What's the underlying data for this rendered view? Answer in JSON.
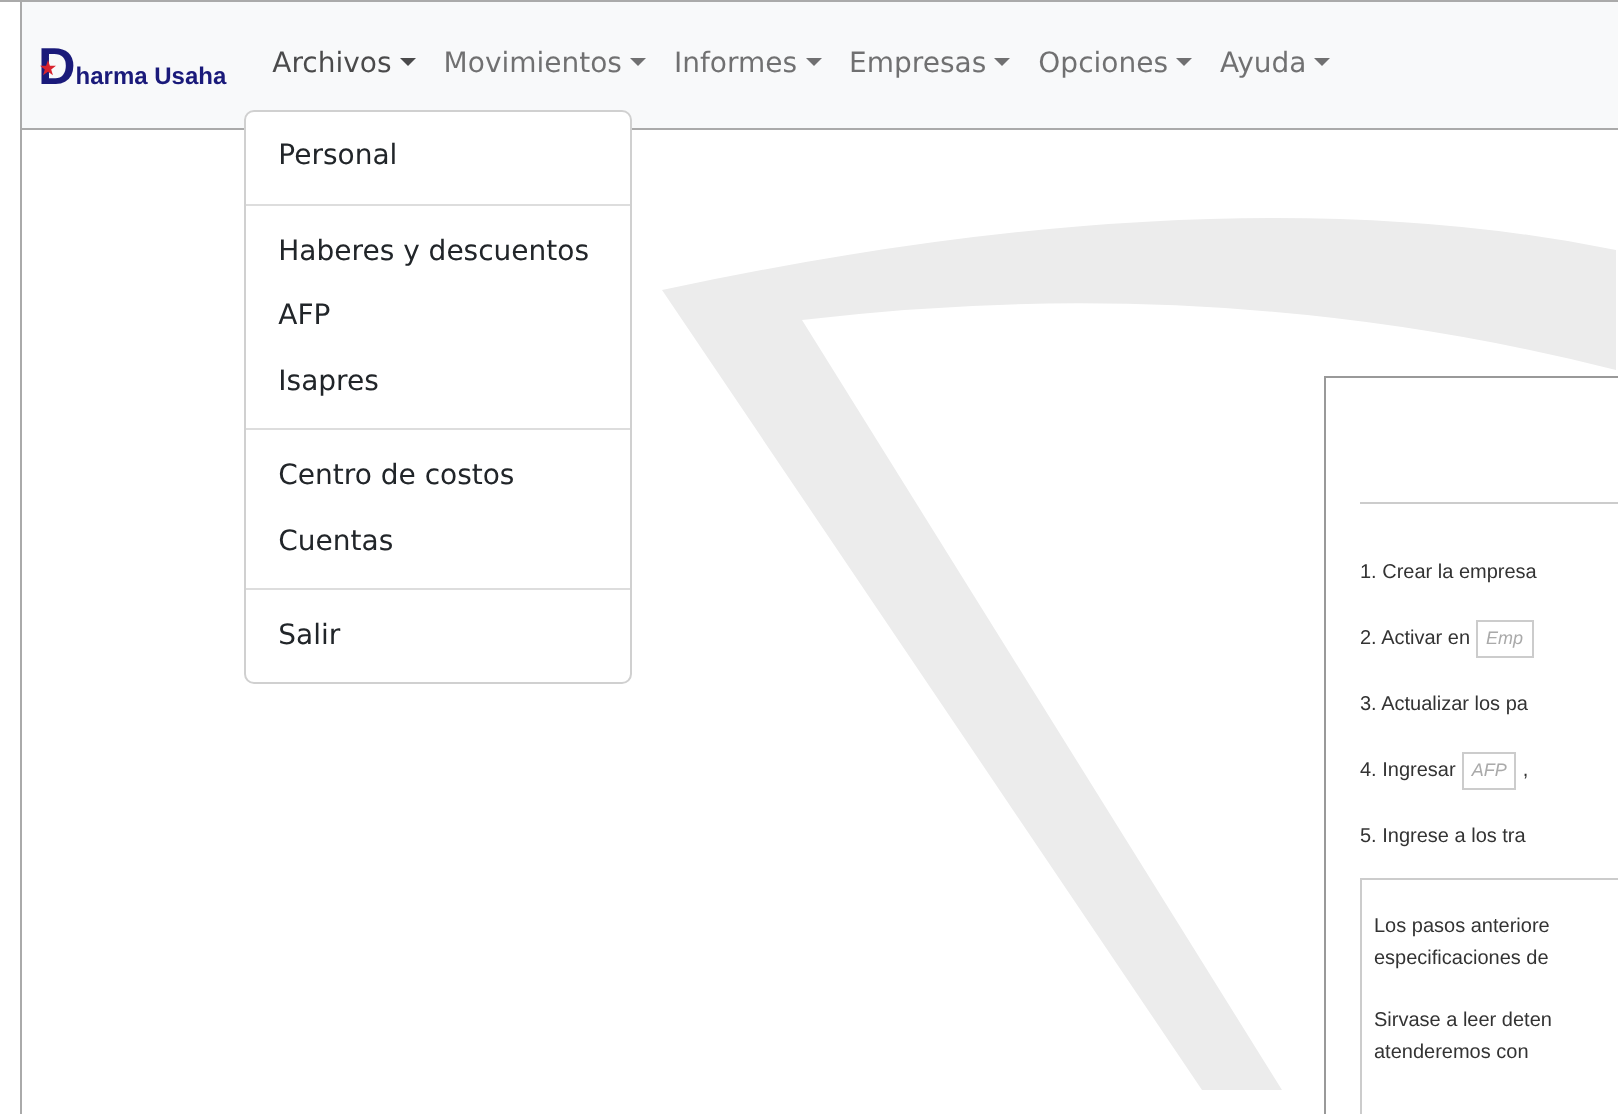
{
  "brand": {
    "text": "Dharma Usaha"
  },
  "menus": [
    {
      "label": "Archivos",
      "expanded": true,
      "groups": [
        [
          "Personal"
        ],
        [
          "Haberes y descuentos",
          "AFP",
          "Isapres"
        ],
        [
          "Centro de costos",
          "Cuentas"
        ],
        [
          "Salir"
        ]
      ]
    },
    {
      "label": "Movimientos",
      "expanded": false
    },
    {
      "label": "Informes",
      "expanded": false
    },
    {
      "label": "Empresas",
      "expanded": false
    },
    {
      "label": "Opciones",
      "expanded": false
    },
    {
      "label": "Ayuda",
      "expanded": false
    }
  ],
  "panel": {
    "steps": [
      [
        {
          "kind": "text",
          "text": "1. Crear la empresa"
        }
      ],
      [
        {
          "kind": "text",
          "text": "2. Activar en"
        },
        {
          "kind": "tag",
          "text": "Emp"
        }
      ],
      [
        {
          "kind": "text",
          "text": "3. Actualizar los pa"
        }
      ],
      [
        {
          "kind": "text",
          "text": "4. Ingresar"
        },
        {
          "kind": "tag",
          "text": "AFP"
        },
        {
          "kind": "text",
          "text": ","
        }
      ],
      [
        {
          "kind": "text",
          "text": "5. Ingrese a los tra"
        }
      ]
    ],
    "notes": [
      [
        "Los pasos anteriore",
        "especificaciones de"
      ],
      [
        "Sirvase a leer deten",
        "atenderemos con"
      ]
    ]
  }
}
